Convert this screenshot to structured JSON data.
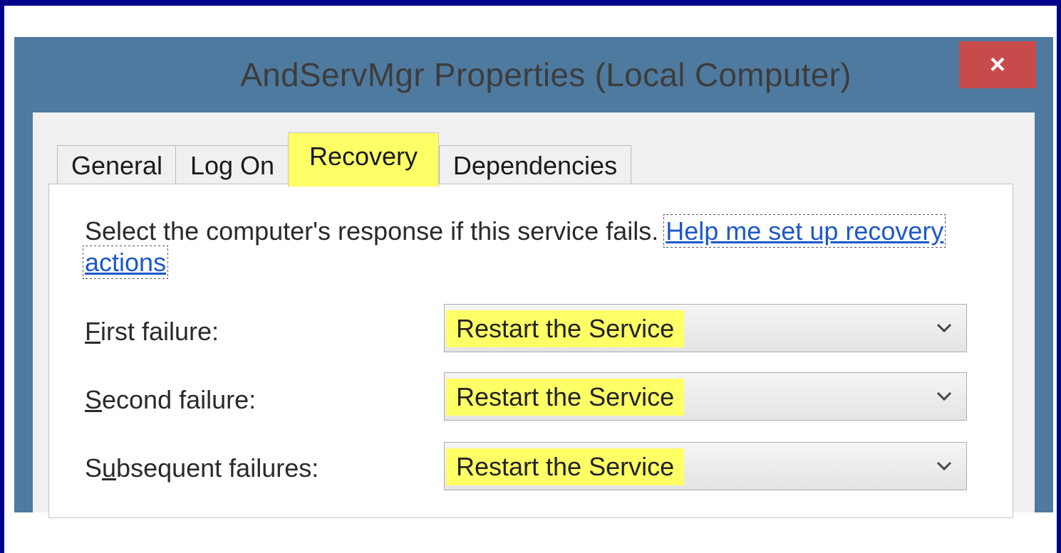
{
  "window": {
    "title": "AndServMgr Properties (Local Computer)",
    "close_label": "×"
  },
  "tabs": [
    {
      "label": "General",
      "active": false
    },
    {
      "label": "Log On",
      "active": false
    },
    {
      "label": "Recovery",
      "active": true
    },
    {
      "label": "Dependencies",
      "active": false
    }
  ],
  "recovery": {
    "description": "Select the computer's response if this service fails.",
    "help_link": "Help me set up recovery actions",
    "rows": [
      {
        "label": "First failure:",
        "accel": "F",
        "value": "Restart the Service"
      },
      {
        "label": "Second failure:",
        "accel": "S",
        "value": "Restart the Service"
      },
      {
        "label": "Subsequent failures:",
        "accel": "u",
        "value": "Restart the Service"
      }
    ]
  },
  "colors": {
    "highlight": "#ffff66",
    "title_bar": "#4f7aa0",
    "close_button": "#c84b4b",
    "link": "#1d58c9"
  }
}
